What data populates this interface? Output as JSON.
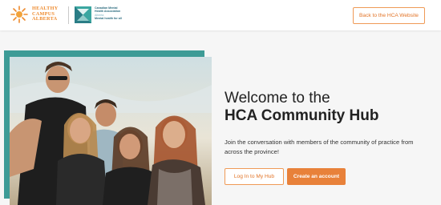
{
  "header": {
    "hca_logo": {
      "icon": "sun-flame-logo-icon",
      "lines": [
        "HEALTHY",
        "CAMPUS",
        "ALBERTA"
      ]
    },
    "cmha_logo": {
      "icon": "cmha-square-logo-icon",
      "lines": [
        "Canadian Mental",
        "Health Association",
        "Alberta",
        "Mental health for all"
      ]
    },
    "back_button_label": "Back to the HCA Website"
  },
  "hero": {
    "photo_alt": "Group of five smiling young people outdoors",
    "title_line1": "Welcome to the",
    "title_line2": "HCA Community Hub",
    "subtitle": "Join the conversation with members of the community of practice from across the province!",
    "login_button_label": "Log In to My Hub",
    "create_button_label": "Create an account"
  },
  "colors": {
    "accent_orange": "#e8813a",
    "teal": "#3d9b96",
    "background": "#f6f6f6"
  }
}
